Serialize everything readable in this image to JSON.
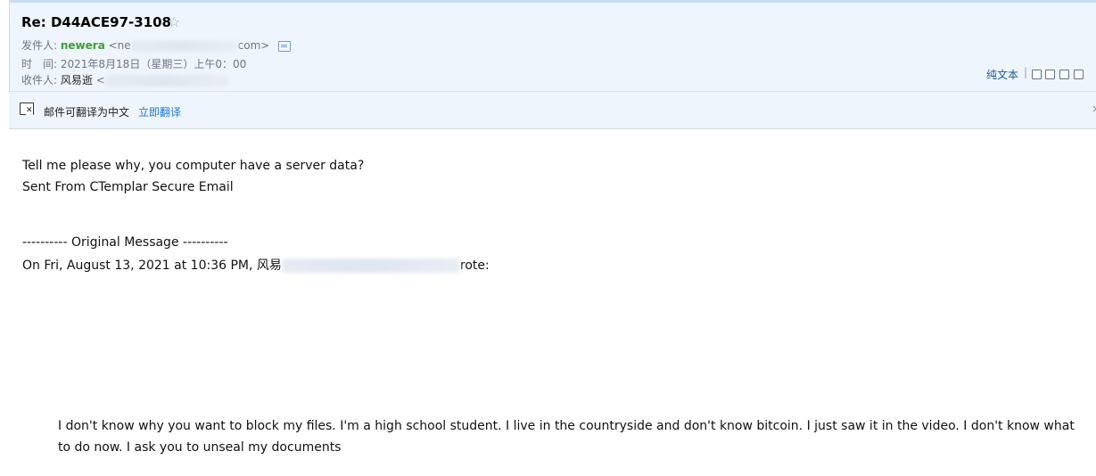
{
  "email": {
    "subject": "Re: D44ACE97-3108",
    "star_icon": "star-outline-icon",
    "from_label": "发件人:",
    "from_name": "newera",
    "from_addr_start": "<ne",
    "from_addr_end": "com>",
    "time_label": "时　间:",
    "time_value": "2021年8月18日（星期三）上午0：00",
    "to_label": "收件人:",
    "to_name": "风易逝",
    "to_addr_start": "<"
  },
  "toolbar": {
    "plain_text": "纯文本",
    "separator": "|",
    "icons": [
      "new-window-icon",
      "copy-icon",
      "download-icon",
      "print-icon"
    ]
  },
  "translate": {
    "message": "邮件可翻译为中文",
    "action": "立即翻译",
    "close": "×"
  },
  "body": {
    "line1": "Tell me please why, you computer have a server data?",
    "line2": "Sent From CTemplar Secure Email",
    "original_header": "---------- Original Message ----------",
    "quote_attr_start": "On Fri, August 13, 2021 at 10:36 PM, 风易",
    "quote_attr_end": "rote:",
    "quoted_text": "I don't know why you want to block my files. I'm a high school student. I live in the countryside and don't know bitcoin. I just saw it in the video. I don't know what to do now. I ask you to unseal my documents"
  },
  "colors": {
    "header_bg": "#eff5fc",
    "sender_green": "#3f9c35",
    "link_blue": "#1e78c8"
  }
}
